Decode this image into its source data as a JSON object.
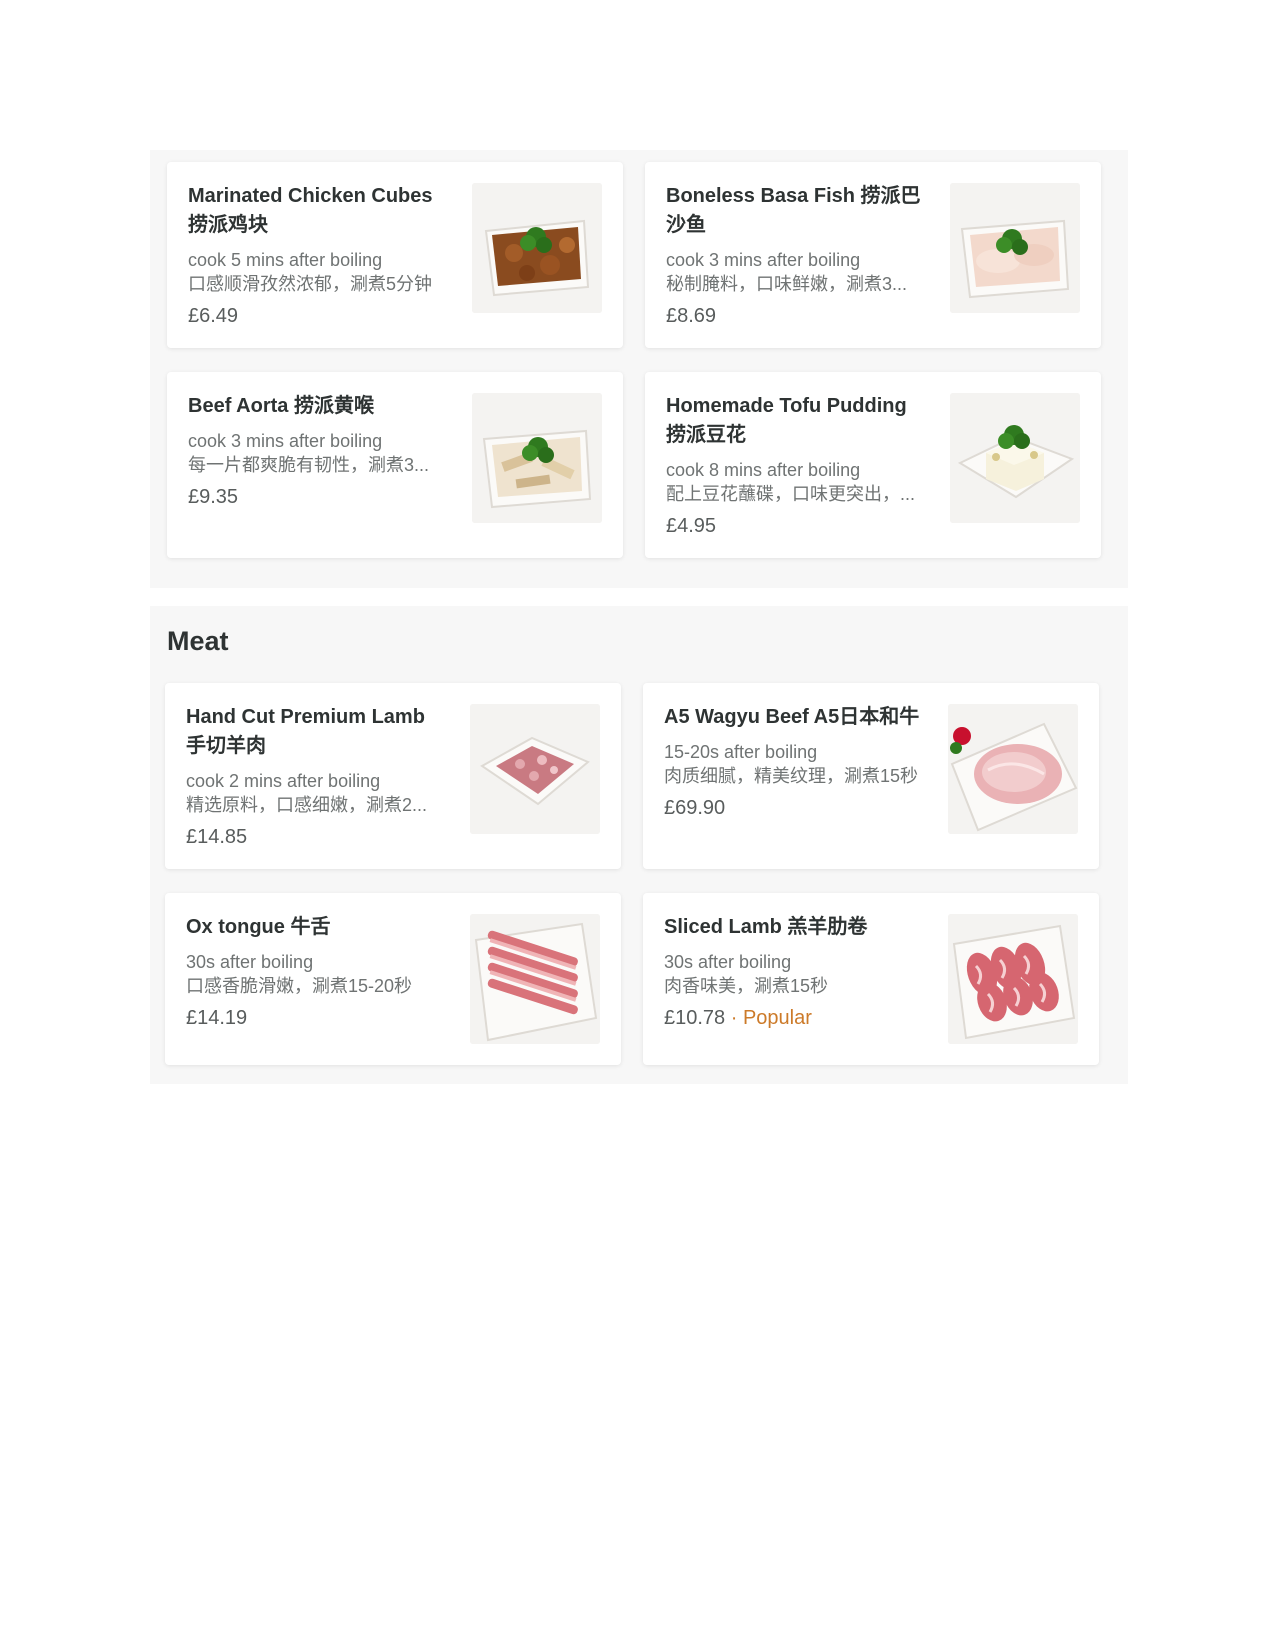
{
  "top_section": {
    "items": [
      {
        "name": "Marinated Chicken Cubes 捞派鸡块",
        "cook": "cook 5 mins after boiling",
        "desc": "口感顺滑孜然浓郁，涮煮5分钟",
        "price": "£6.49",
        "image": "chicken-cubes-image"
      },
      {
        "name": "Boneless Basa Fish 捞派巴沙鱼",
        "cook": "cook 3 mins after boiling",
        "desc": "秘制腌料，口味鲜嫩，涮煮3...",
        "price": "£8.69",
        "image": "basa-fish-image"
      },
      {
        "name": "Beef Aorta 捞派黄喉",
        "cook": "cook 3 mins after boiling",
        "desc": "每一片都爽脆有韧性，涮煮3...",
        "price": "£9.35",
        "image": "beef-aorta-image"
      },
      {
        "name": "Homemade Tofu Pudding 捞派豆花",
        "cook": "cook 8 mins after boiling",
        "desc": "配上豆花蘸碟，口味更突出，...",
        "price": "£4.95",
        "image": "tofu-pudding-image"
      }
    ]
  },
  "meat_section": {
    "title": "Meat",
    "items": [
      {
        "name": "Hand Cut Premium Lamb 手切羊肉",
        "cook": "cook 2 mins after boiling",
        "desc": "精选原料，口感细嫩，涮煮2...",
        "price": "£14.85",
        "image": "hand-cut-lamb-image"
      },
      {
        "name": "A5 Wagyu Beef A5日本和牛",
        "cook": "15-20s after boiling",
        "desc": "肉质细腻，精美纹理，涮煮15秒",
        "price": "£69.90",
        "image": "wagyu-beef-image"
      },
      {
        "name": "Ox tongue 牛舌",
        "cook": "30s after boiling",
        "desc": "口感香脆滑嫩，涮煮15-20秒",
        "price": "£14.19",
        "image": "ox-tongue-image"
      },
      {
        "name": "Sliced Lamb 羔羊肋卷",
        "cook": "30s after boiling",
        "desc": "肉香味美，涮煮15秒",
        "price": "£10.78",
        "separator": "·",
        "badge": "Popular",
        "image": "sliced-lamb-image"
      }
    ]
  },
  "colors": {
    "popular": "#cc7a29",
    "panel": "#f7f7f7",
    "text": "#2e3333",
    "muted": "#6f7373"
  }
}
